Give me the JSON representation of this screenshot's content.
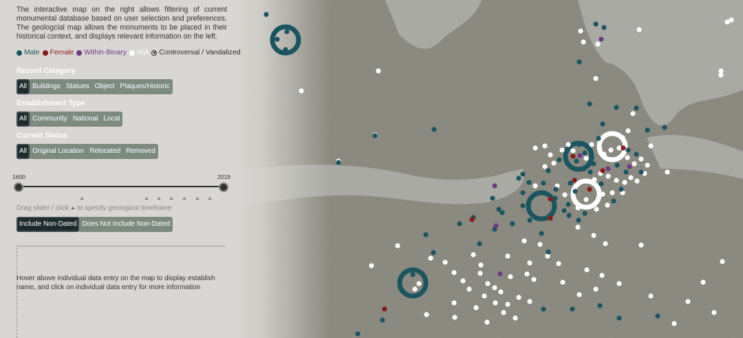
{
  "intro": "The interactive map on the right allows filtering of current monumental database based on user selection and preferences. The geologcial map allows the monuments to be placed in their historical context, and displays relevant information on the left.",
  "legend": [
    {
      "label": "Male",
      "color": "#1b5560",
      "kind": "dot"
    },
    {
      "label": "Female",
      "color": "#8a1a1a",
      "kind": "dot"
    },
    {
      "label": "Within-Binary",
      "color": "#6e3a86",
      "kind": "dot"
    },
    {
      "label": "N/A",
      "color": "#ffffff",
      "kind": "dot"
    },
    {
      "label": "Controversal / Vandalized",
      "color": "#222222",
      "kind": "ring"
    }
  ],
  "record_category": {
    "title": "Record Category",
    "options": [
      "All",
      "Buildings",
      "Statues",
      "Object",
      "Plaques/Historic"
    ],
    "selected": "All"
  },
  "establishment_type": {
    "title": "Establishment Type",
    "options": [
      "All",
      "Community",
      "National",
      "Local"
    ],
    "selected": "All"
  },
  "current_status": {
    "title": "Current Status",
    "options": [
      "All",
      "Original Location",
      "Relocated",
      "Removed"
    ],
    "selected": "All"
  },
  "slider": {
    "min_label": "1600",
    "max_label": "2019",
    "start": 1600,
    "end": 2019
  },
  "slider_hint_before": "Drag slider / click",
  "slider_hint_after": "to specify geological timeframe",
  "non_dated": {
    "options": [
      "Include Non-Dated",
      "Does Not Include Non-Dated"
    ],
    "selected": "Include Non-Dated"
  },
  "info_text": "Hover above individual data entry on the map to display establish name, and click on individual data entry for more information",
  "map": {
    "colors": {
      "male": "#1b5560",
      "female": "#8a1a1a",
      "binary": "#6e3a86",
      "na": "#ffffff"
    }
  }
}
